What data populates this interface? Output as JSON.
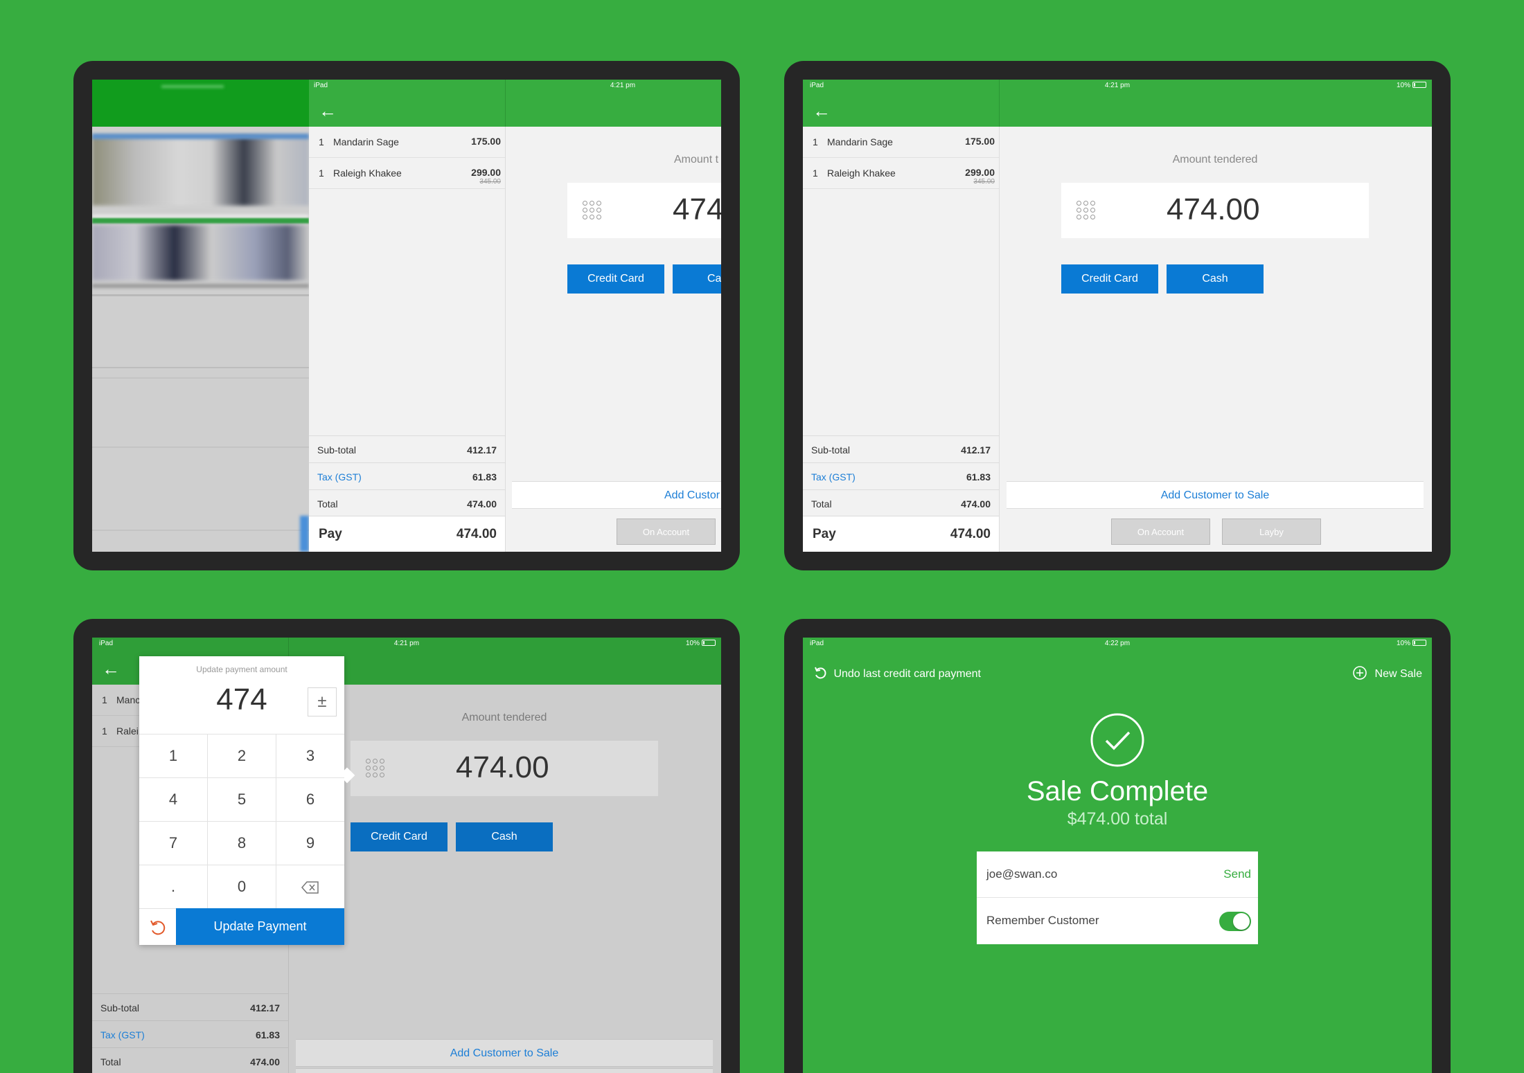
{
  "status": {
    "carrier": "iPad",
    "time_a": "4:21 pm",
    "time_d": "4:22 pm",
    "battery": "10%"
  },
  "items": [
    {
      "qty": "1",
      "name": "Mandarin Sage",
      "price": "175.00",
      "orig": ""
    },
    {
      "qty": "1",
      "name": "Raleigh Khakee",
      "price": "299.00",
      "orig": "345.00"
    }
  ],
  "short_names": [
    "Manc",
    "Ralei"
  ],
  "summary": {
    "subtotal_label": "Sub-total",
    "subtotal": "412.17",
    "tax_label": "Tax (GST)",
    "tax": "61.83",
    "total_label": "Total",
    "total": "474.00",
    "pay_label": "Pay",
    "pay": "474.00"
  },
  "payment": {
    "amount_label": "Amount tendered",
    "amount_label_cut": "Amount t",
    "amount": "474.00",
    "amount_cut": "474",
    "credit_card": "Credit Card",
    "cash": "Cash",
    "cash_cut": "Ca",
    "add_customer": "Add Customer to Sale",
    "add_customer_cut": "Add Custor",
    "on_account": "On Account",
    "layby": "Layby"
  },
  "keypad": {
    "title": "Update payment amount",
    "value": "474",
    "plusminus": "±",
    "keys": [
      "1",
      "2",
      "3",
      "4",
      "5",
      "6",
      "7",
      "8",
      "9",
      ".",
      "0"
    ],
    "update": "Update Payment"
  },
  "complete": {
    "undo": "Undo last credit card payment",
    "new_sale": "New Sale",
    "title": "Sale Complete",
    "total": "$474.00 total",
    "email": "joe@swan.co",
    "send": "Send",
    "remember": "Remember Customer"
  },
  "colors": {
    "brand_green": "#37ad40",
    "bezel": "#262626",
    "button_blue": "#0a7ad4",
    "link_blue": "#1c7ed6"
  }
}
